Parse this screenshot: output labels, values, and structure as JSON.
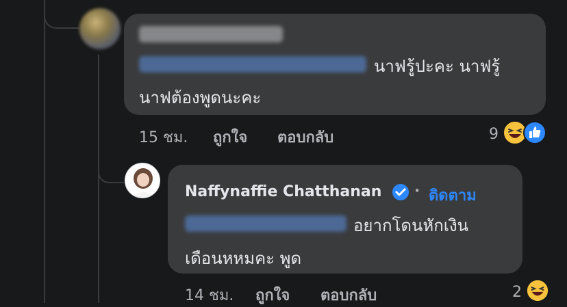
{
  "comment1": {
    "time": "15 ชม.",
    "like_label": "ถูกใจ",
    "reply_label": "ตอบกลับ",
    "reaction_count": "9",
    "text_line1": "นาฟรู้ปะคะ นาฟรู้",
    "text_line2": "นาฟต้องพูดนะคะ"
  },
  "comment2": {
    "author": "Naffynaffie Chatthanan",
    "follow_label": "ติดตาม",
    "time": "14 ชม.",
    "like_label": "ถูกใจ",
    "reply_label": "ตอบกลับ",
    "reaction_count": "2",
    "text_line1": "อยากโดนหักเงิน",
    "text_line2": "เดือนหหมคะ พูด"
  },
  "colors": {
    "background": "#18191a",
    "bubble": "#3a3b3c",
    "text": "#e4e6eb",
    "meta": "#b0b3b8",
    "mention_blue": "#5b8fe0",
    "verified": "#2d88ff",
    "like_blue": "#2d88ff",
    "haha_yellow": "#f7c33c"
  },
  "icons": [
    "haha-reaction-icon",
    "like-reaction-icon",
    "verified-badge-icon"
  ]
}
